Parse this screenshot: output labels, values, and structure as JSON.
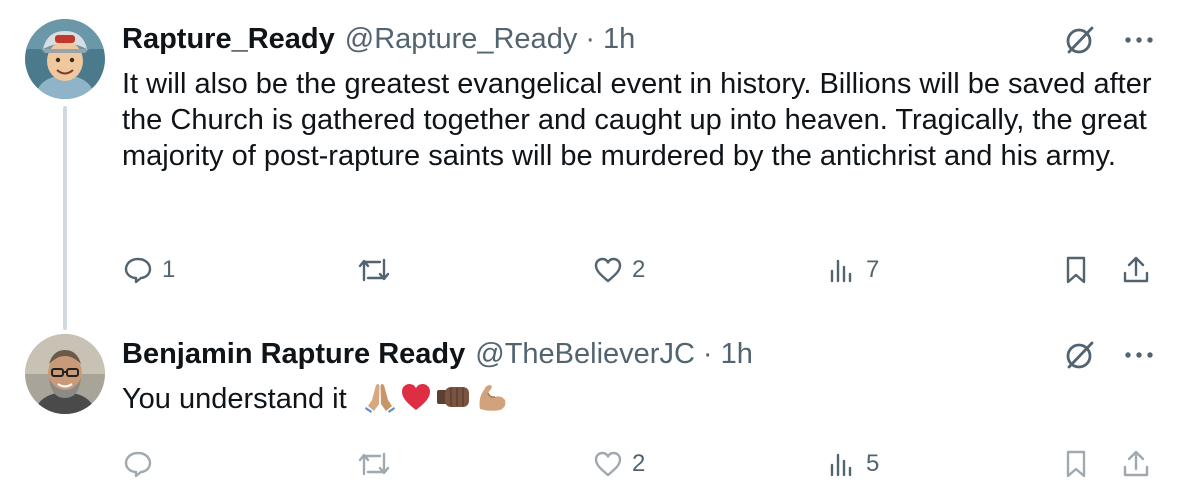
{
  "tweets": [
    {
      "name": "Rapture_Ready",
      "handle": "@Rapture_Ready",
      "separator": "·",
      "time": "1h",
      "text": "It will also be the greatest evangelical event in history. Billions will be saved after the Church is gathered together and caught up into heaven. Tragically, the great majority of post-rapture saints will be murdered by the antichrist and his army.",
      "replies": "1",
      "retweets": "",
      "likes": "2",
      "views": "7"
    },
    {
      "name": "Benjamin Rapture Ready",
      "handle": "@TheBelieverJC",
      "separator": "·",
      "time": "1h",
      "text": "You understand it",
      "emojis": [
        "folded-hands",
        "red-heart",
        "fist-bump",
        "flexed-biceps"
      ],
      "replies": "",
      "retweets": "",
      "likes": "2",
      "views": "5"
    }
  ],
  "colors": {
    "text": "#0f1419",
    "secondary": "#536471",
    "thread_line": "#cfd9de"
  },
  "icons": [
    "grok-icon",
    "more-icon",
    "reply-icon",
    "retweet-icon",
    "like-icon",
    "views-icon",
    "bookmark-icon",
    "share-icon"
  ]
}
